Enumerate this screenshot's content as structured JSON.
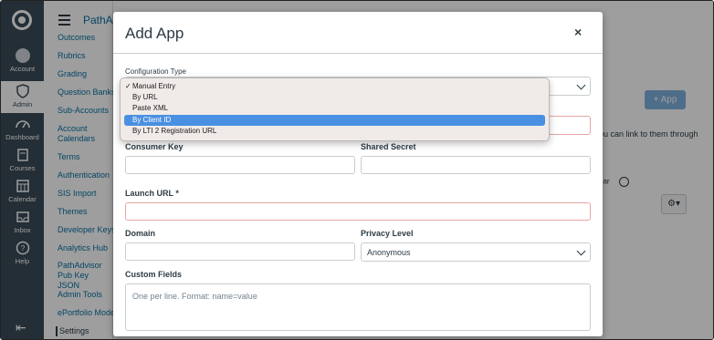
{
  "global_nav": {
    "items": [
      {
        "label": "Account"
      },
      {
        "label": "Admin"
      },
      {
        "label": "Dashboard"
      },
      {
        "label": "Courses"
      },
      {
        "label": "Calendar"
      },
      {
        "label": "Inbox"
      },
      {
        "label": "Help"
      }
    ]
  },
  "breadcrumb": "PathAdvisor",
  "course_nav": [
    "Outcomes",
    "Rubrics",
    "Grading",
    "Question Banks",
    "Sub-Accounts",
    "Account Calendars",
    "Terms",
    "Authentication",
    "SIS Import",
    "Themes",
    "Developer Keys",
    "Analytics Hub",
    "PathAdvisor Pub Key JSON",
    "Admin Tools",
    "ePortfolio Moder",
    "Settings"
  ],
  "background": {
    "add_app_label": "App",
    "text_line": "ou can link to them through",
    "column_label": "bar"
  },
  "modal": {
    "title": "Add App",
    "close": "×",
    "config_type_label": "Configuration Type",
    "consumer_key_label": "Consumer Key",
    "shared_secret_label": "Shared Secret",
    "launch_url_label": "Launch URL *",
    "domain_label": "Domain",
    "privacy_level_label": "Privacy Level",
    "privacy_level_value": "Anonymous",
    "custom_fields_label": "Custom Fields",
    "custom_fields_placeholder": "One per line. Format: name=value"
  },
  "dropdown": {
    "options": [
      {
        "label": "Manual Entry",
        "checked": true
      },
      {
        "label": "By URL"
      },
      {
        "label": "Paste XML"
      },
      {
        "label": "By Client ID",
        "highlighted": true
      },
      {
        "label": "By LTI 2 Registration URL"
      }
    ]
  },
  "colors": {
    "nav_bg": "#394b58",
    "link": "#0770a3",
    "highlight": "#4a90e2",
    "error_border": "#e8a6a6"
  }
}
